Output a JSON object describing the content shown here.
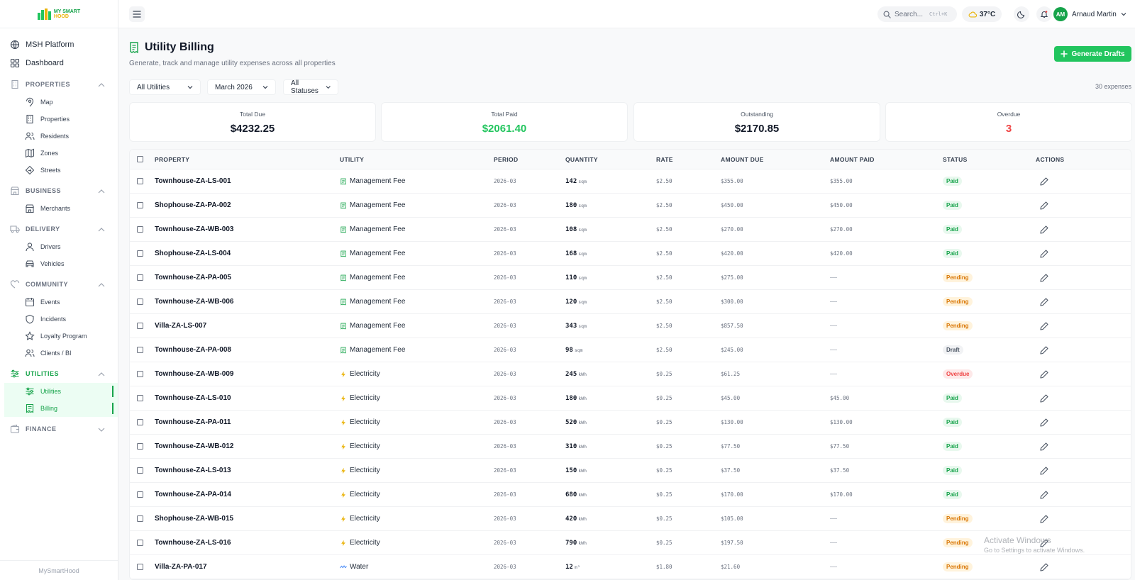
{
  "app": {
    "logo_line1": "MY SMART",
    "logo_line2": "HOOD",
    "footer": "MySmartHood"
  },
  "colors": {
    "accent": "#22c55e",
    "accent_dark": "#16a34a",
    "danger": "#ef4444",
    "warning": "#d97706"
  },
  "sidebar": {
    "top": [
      {
        "label": "MSH Platform",
        "icon": "globe-icon"
      },
      {
        "label": "Dashboard",
        "icon": "grid-icon"
      }
    ],
    "sections": [
      {
        "label": "PROPERTIES",
        "icon": "building-icon",
        "expanded": true,
        "items": [
          {
            "label": "Map",
            "icon": "pin-icon"
          },
          {
            "label": "Properties",
            "icon": "building-icon"
          },
          {
            "label": "Residents",
            "icon": "users-icon"
          },
          {
            "label": "Zones",
            "icon": "map-icon"
          },
          {
            "label": "Streets",
            "icon": "signpost-icon"
          }
        ]
      },
      {
        "label": "BUSINESS",
        "icon": "store-icon",
        "expanded": true,
        "items": [
          {
            "label": "Merchants",
            "icon": "store-icon"
          }
        ]
      },
      {
        "label": "DELIVERY",
        "icon": "truck-icon",
        "expanded": true,
        "items": [
          {
            "label": "Drivers",
            "icon": "user-icon"
          },
          {
            "label": "Vehicles",
            "icon": "car-icon"
          }
        ]
      },
      {
        "label": "COMMUNITY",
        "icon": "heart-icon",
        "expanded": true,
        "items": [
          {
            "label": "Events",
            "icon": "calendar-icon"
          },
          {
            "label": "Incidents",
            "icon": "shield-icon"
          },
          {
            "label": "Loyalty Program",
            "icon": "star-icon"
          },
          {
            "label": "Clients / BI",
            "icon": "users-icon"
          }
        ]
      },
      {
        "label": "UTILITIES",
        "icon": "sliders-icon",
        "expanded": true,
        "active": true,
        "items": [
          {
            "label": "Utilities",
            "icon": "sliders-icon",
            "active": true
          },
          {
            "label": "Billing",
            "icon": "receipt-icon",
            "active": true
          }
        ]
      },
      {
        "label": "FINANCE",
        "icon": "wallet-icon",
        "expanded": false,
        "items": []
      }
    ]
  },
  "topbar": {
    "search_placeholder": "Search...",
    "search_shortcut": "Ctrl+K",
    "temperature": "37°C",
    "user_initials": "AM",
    "user_name": "Arnaud Martin"
  },
  "page": {
    "title": "Utility Billing",
    "subtitle": "Generate, track and manage utility expenses across all properties",
    "generate_button": "Generate Drafts",
    "filters": {
      "utility": "All Utilities",
      "period": "March 2026",
      "status": "All Statuses"
    },
    "expense_count": "30 expenses"
  },
  "stats": [
    {
      "label": "Total Due",
      "value": "$4232.25",
      "color": "#111827"
    },
    {
      "label": "Total Paid",
      "value": "$2061.40",
      "color": "#22c55e"
    },
    {
      "label": "Outstanding",
      "value": "$2170.85",
      "color": "#111827"
    },
    {
      "label": "Overdue",
      "value": "3",
      "color": "#ef4444"
    }
  ],
  "table": {
    "columns": [
      "PROPERTY",
      "UTILITY",
      "PERIOD",
      "QUANTITY",
      "RATE",
      "AMOUNT DUE",
      "AMOUNT PAID",
      "STATUS",
      "ACTIONS"
    ],
    "rows": [
      {
        "property": "Townhouse-ZA-LS-001",
        "utility": "Management Fee",
        "utility_icon": "receipt-icon",
        "period": "2026-03",
        "quantity": "142",
        "unit": "sqm",
        "rate": "$2.50",
        "amount_due": "$355.00",
        "amount_paid": "$355.00",
        "status": "Paid"
      },
      {
        "property": "Shophouse-ZA-PA-002",
        "utility": "Management Fee",
        "utility_icon": "receipt-icon",
        "period": "2026-03",
        "quantity": "180",
        "unit": "sqm",
        "rate": "$2.50",
        "amount_due": "$450.00",
        "amount_paid": "$450.00",
        "status": "Paid"
      },
      {
        "property": "Townhouse-ZA-WB-003",
        "utility": "Management Fee",
        "utility_icon": "receipt-icon",
        "period": "2026-03",
        "quantity": "108",
        "unit": "sqm",
        "rate": "$2.50",
        "amount_due": "$270.00",
        "amount_paid": "$270.00",
        "status": "Paid"
      },
      {
        "property": "Shophouse-ZA-LS-004",
        "utility": "Management Fee",
        "utility_icon": "receipt-icon",
        "period": "2026-03",
        "quantity": "168",
        "unit": "sqm",
        "rate": "$2.50",
        "amount_due": "$420.00",
        "amount_paid": "$420.00",
        "status": "Paid"
      },
      {
        "property": "Townhouse-ZA-PA-005",
        "utility": "Management Fee",
        "utility_icon": "receipt-icon",
        "period": "2026-03",
        "quantity": "110",
        "unit": "sqm",
        "rate": "$2.50",
        "amount_due": "$275.00",
        "amount_paid": "—",
        "status": "Pending"
      },
      {
        "property": "Townhouse-ZA-WB-006",
        "utility": "Management Fee",
        "utility_icon": "receipt-icon",
        "period": "2026-03",
        "quantity": "120",
        "unit": "sqm",
        "rate": "$2.50",
        "amount_due": "$300.00",
        "amount_paid": "—",
        "status": "Pending"
      },
      {
        "property": "Villa-ZA-LS-007",
        "utility": "Management Fee",
        "utility_icon": "receipt-icon",
        "period": "2026-03",
        "quantity": "343",
        "unit": "sqm",
        "rate": "$2.50",
        "amount_due": "$857.50",
        "amount_paid": "—",
        "status": "Pending"
      },
      {
        "property": "Townhouse-ZA-PA-008",
        "utility": "Management Fee",
        "utility_icon": "receipt-icon",
        "period": "2026-03",
        "quantity": "98",
        "unit": "sqm",
        "rate": "$2.50",
        "amount_due": "$245.00",
        "amount_paid": "—",
        "status": "Draft"
      },
      {
        "property": "Townhouse-ZA-WB-009",
        "utility": "Electricity",
        "utility_icon": "bolt-icon",
        "period": "2026-03",
        "quantity": "245",
        "unit": "kWh",
        "rate": "$0.25",
        "amount_due": "$61.25",
        "amount_paid": "—",
        "status": "Overdue"
      },
      {
        "property": "Townhouse-ZA-LS-010",
        "utility": "Electricity",
        "utility_icon": "bolt-icon",
        "period": "2026-03",
        "quantity": "180",
        "unit": "kWh",
        "rate": "$0.25",
        "amount_due": "$45.00",
        "amount_paid": "$45.00",
        "status": "Paid"
      },
      {
        "property": "Townhouse-ZA-PA-011",
        "utility": "Electricity",
        "utility_icon": "bolt-icon",
        "period": "2026-03",
        "quantity": "520",
        "unit": "kWh",
        "rate": "$0.25",
        "amount_due": "$130.00",
        "amount_paid": "$130.00",
        "status": "Paid"
      },
      {
        "property": "Townhouse-ZA-WB-012",
        "utility": "Electricity",
        "utility_icon": "bolt-icon",
        "period": "2026-03",
        "quantity": "310",
        "unit": "kWh",
        "rate": "$0.25",
        "amount_due": "$77.50",
        "amount_paid": "$77.50",
        "status": "Paid"
      },
      {
        "property": "Townhouse-ZA-LS-013",
        "utility": "Electricity",
        "utility_icon": "bolt-icon",
        "period": "2026-03",
        "quantity": "150",
        "unit": "kWh",
        "rate": "$0.25",
        "amount_due": "$37.50",
        "amount_paid": "$37.50",
        "status": "Paid"
      },
      {
        "property": "Townhouse-ZA-PA-014",
        "utility": "Electricity",
        "utility_icon": "bolt-icon",
        "period": "2026-03",
        "quantity": "680",
        "unit": "kWh",
        "rate": "$0.25",
        "amount_due": "$170.00",
        "amount_paid": "$170.00",
        "status": "Paid"
      },
      {
        "property": "Shophouse-ZA-WB-015",
        "utility": "Electricity",
        "utility_icon": "bolt-icon",
        "period": "2026-03",
        "quantity": "420",
        "unit": "kWh",
        "rate": "$0.25",
        "amount_due": "$105.00",
        "amount_paid": "—",
        "status": "Pending"
      },
      {
        "property": "Townhouse-ZA-LS-016",
        "utility": "Electricity",
        "utility_icon": "bolt-icon",
        "period": "2026-03",
        "quantity": "790",
        "unit": "kWh",
        "rate": "$0.25",
        "amount_due": "$197.50",
        "amount_paid": "—",
        "status": "Pending"
      },
      {
        "property": "Villa-ZA-PA-017",
        "utility": "Water",
        "utility_icon": "wave-icon",
        "period": "2026-03",
        "quantity": "12",
        "unit": "m³",
        "rate": "$1.80",
        "amount_due": "$21.60",
        "amount_paid": "—",
        "status": "Pending"
      }
    ]
  },
  "watermark": {
    "line1": "Activate Windows",
    "line2": "Go to Settings to activate Windows."
  }
}
